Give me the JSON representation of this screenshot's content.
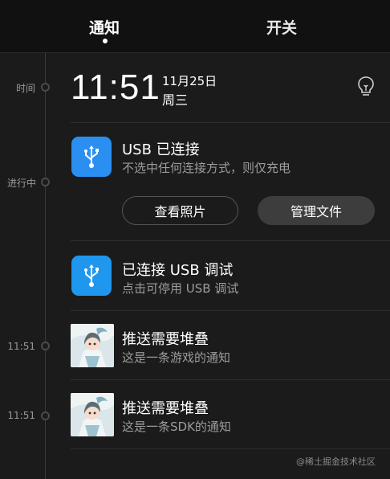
{
  "tabs": {
    "notify": "通知",
    "switch": "开关"
  },
  "timeline": {
    "time_label": "时间",
    "ongoing_label": "进行中",
    "item3_time": "11:51",
    "item4_time": "11:51"
  },
  "clock": {
    "time": "11:51",
    "date": "11月25日",
    "weekday": "周三"
  },
  "usb_card": {
    "icon": "usb-icon",
    "title": "USB 已连接",
    "subtitle": "不选中任何连接方式，则仅充电",
    "btn_photos": "查看照片",
    "btn_files": "管理文件"
  },
  "debug_card": {
    "icon": "usb-icon",
    "title": "已连接 USB 调试",
    "subtitle": "点击可停用 USB 调试"
  },
  "notifications": [
    {
      "title": "推送需要堆叠",
      "subtitle": "这是一条游戏的通知"
    },
    {
      "title": "推送需要堆叠",
      "subtitle": "这是一条SDK的通知"
    }
  ],
  "watermark": "@稀土掘金技术社区",
  "colors": {
    "accent": "#2b8ff2",
    "background": "#1b1b1b",
    "secondary_text": "#9c9c9c"
  }
}
